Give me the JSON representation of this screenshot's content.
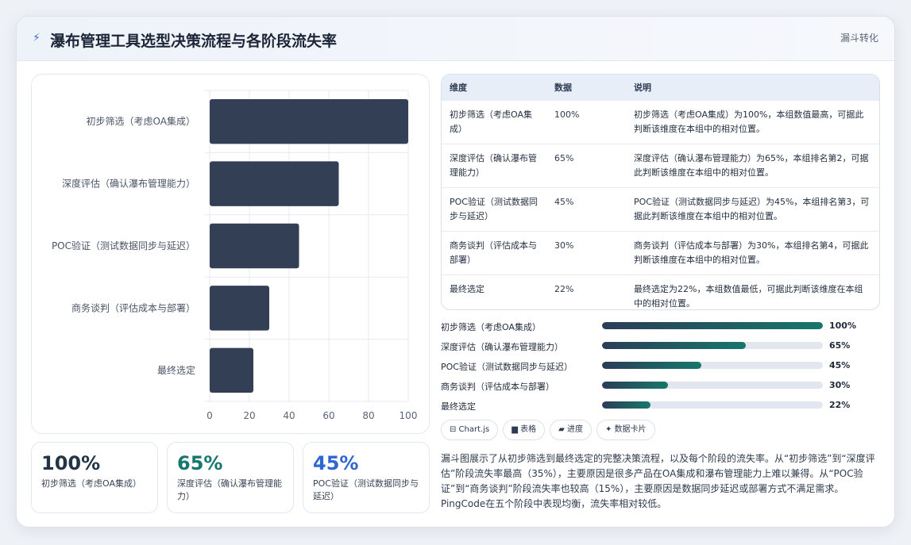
{
  "header": {
    "title": "瀑布管理工具选型决策流程与各阶段流失率",
    "badge": "漏斗转化"
  },
  "colors": {
    "bar": "#323f55",
    "kpi1": "#243447",
    "kpi2": "#17776c",
    "kpi3": "#2f66d0"
  },
  "chart_data": {
    "type": "bar",
    "orientation": "horizontal",
    "categories": [
      "初步筛选（考虑OA集成）",
      "深度评估（确认瀑布管理能力）",
      "POC验证（测试数据同步与延迟）",
      "商务谈判（评估成本与部署）",
      "最终选定"
    ],
    "values": [
      100,
      65,
      45,
      30,
      22
    ],
    "xlim": [
      0,
      100
    ],
    "xticks": [
      "0",
      "20",
      "40",
      "60",
      "80",
      "100"
    ],
    "grid": true
  },
  "kpis": [
    {
      "value": "100%",
      "label": "初步筛选（考虑OA集成）"
    },
    {
      "value": "65%",
      "label": "深度评估（确认瀑布管理能力）"
    },
    {
      "value": "45%",
      "label": "POC验证（测试数据同步与延迟）"
    }
  ],
  "table": {
    "headers": [
      "维度",
      "数据",
      "说明"
    ],
    "rows": [
      {
        "name": "初步筛选（考虑OA集成）",
        "value": "100%",
        "note": "初步筛选（考虑OA集成）为100%，本组数值最高，可据此判断该维度在本组中的相对位置。"
      },
      {
        "name": "深度评估（确认瀑布管理能力）",
        "value": "65%",
        "note": "深度评估（确认瀑布管理能力）为65%，本组排名第2，可据此判断该维度在本组中的相对位置。"
      },
      {
        "name": "POC验证（测试数据同步与延迟）",
        "value": "45%",
        "note": "POC验证（测试数据同步与延迟）为45%，本组排名第3，可据此判断该维度在本组中的相对位置。"
      },
      {
        "name": "商务谈判（评估成本与部署）",
        "value": "30%",
        "note": "商务谈判（评估成本与部署）为30%，本组排名第4，可据此判断该维度在本组中的相对位置。"
      },
      {
        "name": "最终选定",
        "value": "22%",
        "note": "最终选定为22%，本组数值最低，可据此判断该维度在本组中的相对位置。"
      }
    ]
  },
  "progress": [
    {
      "label": "初步筛选（考虑OA集成）",
      "text": "100%",
      "pct": 100
    },
    {
      "label": "深度评估（确认瀑布管理能力）",
      "text": "65%",
      "pct": 65
    },
    {
      "label": "POC验证（测试数据同步与延迟）",
      "text": "45%",
      "pct": 45
    },
    {
      "label": "商务谈判（评估成本与部署）",
      "text": "30%",
      "pct": 30
    },
    {
      "label": "最终选定",
      "text": "22%",
      "pct": 22
    }
  ],
  "chips": [
    "⊟ Chart.js",
    "▆ 表格",
    "▰ 进度",
    "✦ 数据卡片"
  ],
  "description": "漏斗图展示了从初步筛选到最终选定的完整决策流程，以及每个阶段的流失率。从“初步筛选”到“深度评估”阶段流失率最高（35%），主要原因是很多产品在OA集成和瀑布管理能力上难以兼得。从“POC验证”到“商务谈判”阶段流失率也较高（15%），主要原因是数据同步延迟或部署方式不满足需求。PingCode在五个阶段中表现均衡，流失率相对较低。"
}
